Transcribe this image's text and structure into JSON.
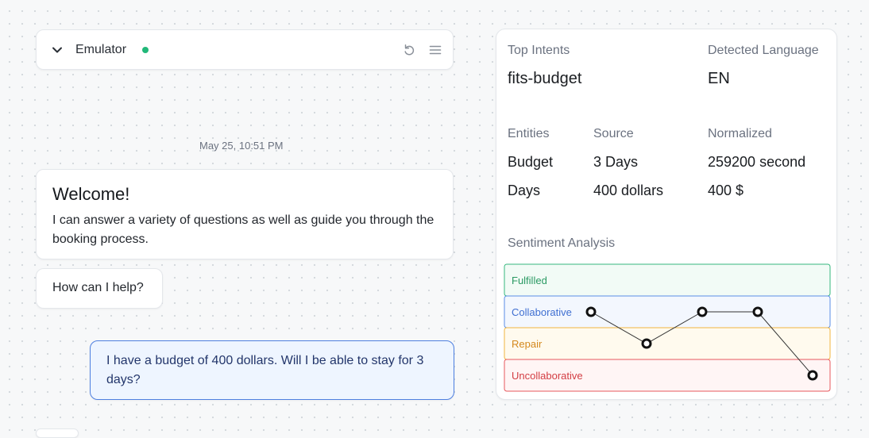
{
  "emulator": {
    "title": "Emulator",
    "status_color": "#21b879",
    "icons": [
      "chevron-down-icon",
      "undo-icon",
      "menu-icon"
    ]
  },
  "chat": {
    "timestamp": "May 25, 10:51 PM",
    "welcome": {
      "title": "Welcome!",
      "body": "I can answer a variety of questions as well as guide you through the booking process."
    },
    "help": "How can I help?",
    "user_message": "I have a budget of 400 dollars. Will I be able to stay for 3 days?",
    "user_bubble_color": "#eef5ff",
    "user_border_color": "#4d7fe0"
  },
  "analysis": {
    "top_intents_label": "Top Intents",
    "top_intent": "fits-budget",
    "detected_language_label": "Detected Language",
    "detected_language": "EN",
    "entities_header": "Entities",
    "source_header": "Source",
    "normalized_header": "Normalized",
    "entities": [
      {
        "entity": "Budget",
        "source": "3 Days",
        "normalized": "259200 second"
      },
      {
        "entity": "Days",
        "source": "400 dollars",
        "normalized": "400 $"
      }
    ],
    "sentiment_label": "Sentiment Analysis"
  },
  "chart_data": {
    "type": "line",
    "categories": [
      "Fulfilled",
      "Collaborative",
      "Repair",
      "Uncollaborative"
    ],
    "band_colors": {
      "Fulfilled": {
        "border": "#35b77d",
        "fill": "#f2fbf6",
        "text": "#2a9a63"
      },
      "Collaborative": {
        "border": "#5a8de6",
        "fill": "#f3f7fe",
        "text": "#3f6fd1"
      },
      "Repair": {
        "border": "#f0b640",
        "fill": "#fffaee",
        "text": "#d4881d"
      },
      "Uncollaborative": {
        "border": "#e7585d",
        "fill": "#fff5f5",
        "text": "#d33d43"
      }
    },
    "points": [
      "Collaborative",
      "Repair",
      "Collaborative",
      "Collaborative",
      "Uncollaborative"
    ]
  }
}
